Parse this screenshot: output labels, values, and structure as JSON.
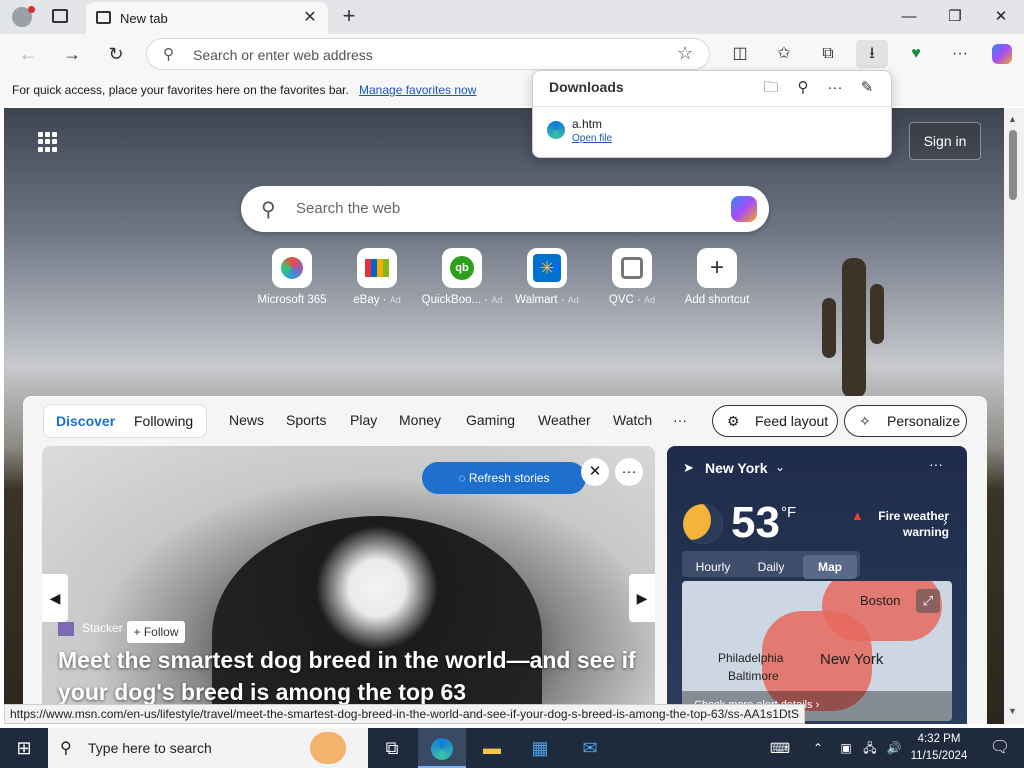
{
  "browser": {
    "tab_title": "New tab",
    "address_placeholder": "Search or enter web address"
  },
  "favorites_bar": {
    "message": "For quick access, place your favorites here on the favorites bar.",
    "link": "Manage favorites now"
  },
  "downloads": {
    "title": "Downloads",
    "file_name": "a.htm",
    "open_label": "Open file"
  },
  "ntp": {
    "sign_in": "Sign in",
    "search_placeholder": "Search the web",
    "quick_links": [
      {
        "label": "Microsoft 365",
        "ad": ""
      },
      {
        "label": "eBay",
        "ad": "Ad"
      },
      {
        "label": "QuickBoo...",
        "ad": "Ad"
      },
      {
        "label": "Walmart",
        "ad": "Ad"
      },
      {
        "label": "QVC",
        "ad": "Ad"
      },
      {
        "label": "Add shortcut",
        "ad": ""
      }
    ]
  },
  "feed": {
    "segments": [
      "Discover",
      "Following"
    ],
    "nav": [
      "News",
      "Sports",
      "Play",
      "Money",
      "Gaming",
      "Weather",
      "Watch",
      "···"
    ],
    "feed_layout": "Feed layout",
    "personalize": "Personalize",
    "refresh": "Refresh stories",
    "provider": "Stacker",
    "follow": "+ Follow",
    "headline": "Meet the smartest dog breed in the world—and see if your dog's breed is among the top 63"
  },
  "weather": {
    "location": "New York",
    "temp": "53",
    "unit": "°F",
    "alert": "Fire weather warning",
    "tabs": [
      "Hourly",
      "Daily",
      "Map"
    ],
    "active_tab": "Map",
    "cities": [
      "Boston",
      "Philadelphia",
      "New York",
      "Baltimore"
    ],
    "map_footer": "Check more alert details"
  },
  "status_url": "https://www.msn.com/en-us/lifestyle/travel/meet-the-smartest-dog-breed-in-the-world-and-see-if-your-dog-s-breed-is-among-the-top-63/ss-AA1s1DtS",
  "taskbar": {
    "search_placeholder": "Type here to search",
    "time": "4:32 PM",
    "date": "11/15/2024"
  },
  "colors": {
    "accent": "#1f6fcf",
    "link": "#1a56c2",
    "taskbar": "#1f2b3d"
  }
}
